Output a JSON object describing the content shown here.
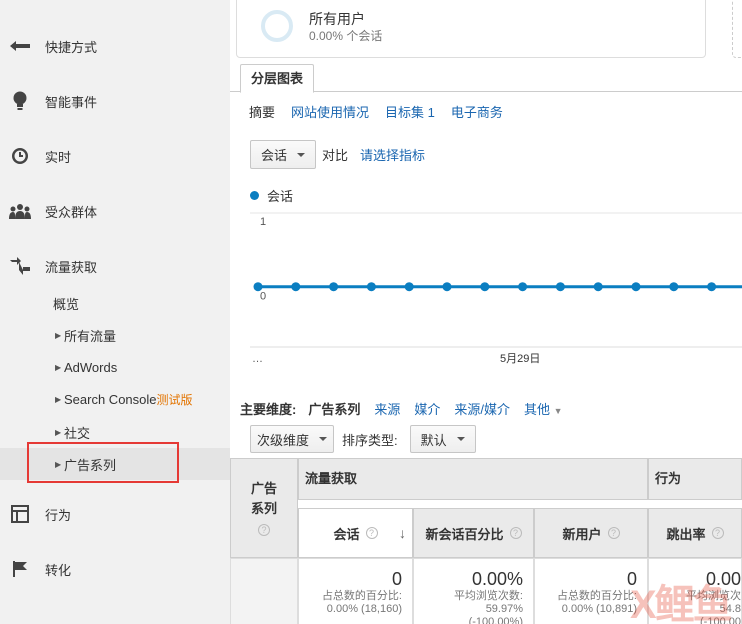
{
  "sidebar": {
    "items": [
      {
        "label": "快捷方式",
        "icon": "shortcut-arrow-icon"
      },
      {
        "label": "智能事件",
        "icon": "lightbulb-icon"
      },
      {
        "label": "实时",
        "icon": "clock-icon"
      },
      {
        "label": "受众群体",
        "icon": "people-icon"
      },
      {
        "label": "流量获取",
        "icon": "acquisition-icon"
      },
      {
        "label": "行为",
        "icon": "behavior-icon"
      },
      {
        "label": "转化",
        "icon": "flag-icon"
      }
    ],
    "acquisition_sub": {
      "overview": "概览",
      "all_traffic": "所有流量",
      "adwords": "AdWords",
      "search_console": "Search Console",
      "search_console_beta": "测试版",
      "social": "社交",
      "campaigns": "广告系列"
    }
  },
  "segment": {
    "name": "所有用户",
    "pct": "0.00% 个会话"
  },
  "tab": {
    "label": "分层图表"
  },
  "subtabs": {
    "summary": "摘要",
    "site_usage": "网站使用情况",
    "goal_set": "目标集 1",
    "ecommerce": "电子商务"
  },
  "metric_picker": {
    "metric": "会话",
    "vs": "对比",
    "select_metric": "请选择指标"
  },
  "legend": {
    "label": "会话"
  },
  "chart_data": {
    "type": "line",
    "series": [
      {
        "name": "会话",
        "values": [
          0,
          0,
          0,
          0,
          0,
          0,
          0,
          0,
          0,
          0,
          0,
          0,
          0,
          0
        ]
      }
    ],
    "y_ticks": [
      "1",
      "0"
    ],
    "ylim": [
      0,
      1
    ],
    "x_tick_labels": [
      "…",
      "5月29日"
    ],
    "color": "#0b7ec1"
  },
  "dimensions": {
    "label": "主要维度:",
    "current": "广告系列",
    "source": "来源",
    "medium": "媒介",
    "source_medium": "来源/媒介",
    "other": "其他"
  },
  "controls": {
    "secondary_dimension": "次级维度",
    "sort_type_label": "排序类型:",
    "sort_type_value": "默认"
  },
  "table": {
    "dim_header": "广告系列",
    "group_acquisition": "流量获取",
    "group_behavior": "行为",
    "col_sessions": "会话",
    "col_new_sessions_pct": "新会话百分比",
    "col_new_users": "新用户",
    "col_bounce_rate": "跳出率",
    "sessions_total": "0",
    "sessions_sub1": "占总数的百分比:",
    "sessions_sub2": "0.00% (18,160)",
    "new_pct_total": "0.00%",
    "new_pct_sub1": "平均浏览次数:",
    "new_pct_sub2": "59.97%",
    "new_pct_sub3": "(-100.00%)",
    "new_users_total": "0",
    "new_users_sub1": "占总数的百分比:",
    "new_users_sub2": "0.00% (10,891)",
    "bounce_total": "0.00",
    "bounce_sub1": "平均浏览次",
    "bounce_sub2": "54.8",
    "bounce_sub3": "(-100.00"
  },
  "watermark": "X鲤鱼"
}
